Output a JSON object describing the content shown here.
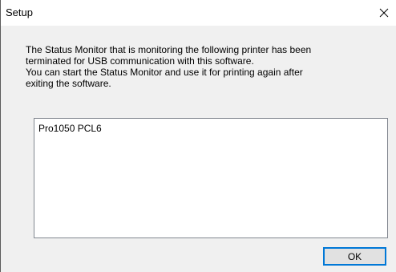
{
  "window": {
    "title": "Setup"
  },
  "message": {
    "text": "The Status Monitor that is monitoring the following printer has been\nterminated for USB communication with this software.\nYou can start the Status Monitor and use it for printing again after\nexiting the software."
  },
  "printer_list": {
    "items": [
      "Pro1050 PCL6"
    ]
  },
  "buttons": {
    "ok_label": "OK"
  },
  "icons": {
    "close": "close-icon"
  },
  "colors": {
    "accent": "#0078d7",
    "dialog_background": "#f0f0f0",
    "title_background": "#ffffff"
  }
}
